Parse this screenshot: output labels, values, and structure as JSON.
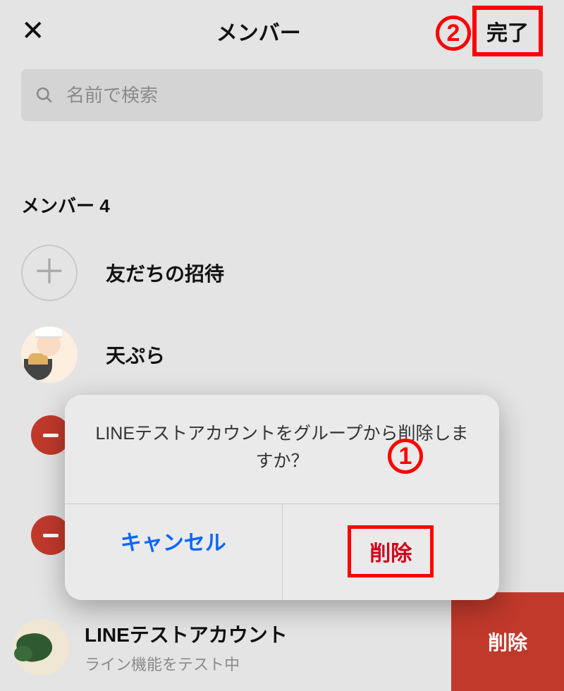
{
  "header": {
    "close_glyph": "✕",
    "title": "メンバー",
    "done_label": "完了"
  },
  "search": {
    "placeholder": "名前で検索"
  },
  "section": {
    "label_prefix": "メンバー",
    "count": "4"
  },
  "invite": {
    "glyph": "＋",
    "label": "友だちの招待"
  },
  "members": [
    {
      "name": "天ぷら"
    },
    {
      "name": ""
    },
    {
      "name": ""
    }
  ],
  "selected_member": {
    "name": "LINEテストアカウント",
    "status": "ライン機能をテスト中"
  },
  "row_delete_label": "削除",
  "sheet": {
    "message": "LINEテストアカウントをグループから削除しますか？",
    "cancel_label": "キャンセル",
    "delete_label": "削除"
  },
  "annotations": {
    "one": "1",
    "two": "2"
  }
}
